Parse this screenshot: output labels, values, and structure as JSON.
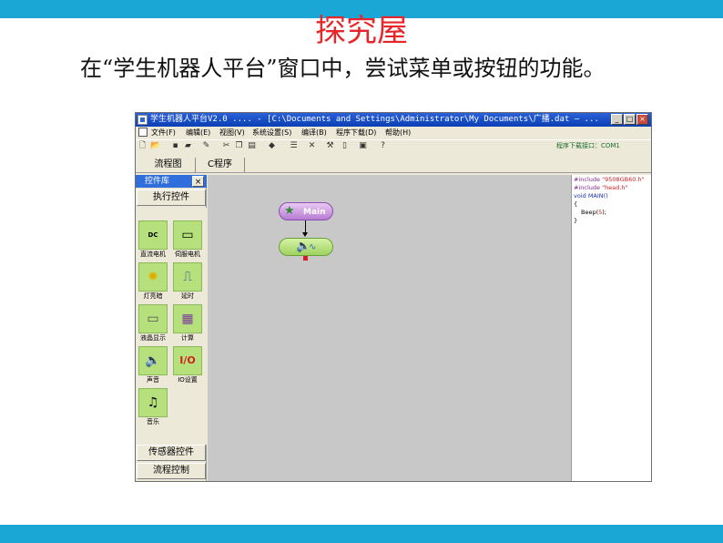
{
  "slide": {
    "title": "探究屋",
    "body": "在“学生机器人平台”窗口中，尝试菜单或按钮的功能。",
    "colors": {
      "band": "#1ba7d6",
      "title": "#e5262a"
    }
  },
  "window": {
    "title": "学生机器人平台V2.0 .... - [C:\\Documents and Settings\\Administrator\\My Documents\\广播.dat — ...",
    "buttons": {
      "minimize": "_",
      "maximize": "□",
      "close": "×"
    },
    "menu": [
      "文件(F)",
      "编辑(E)",
      "视图(V)",
      "系统设置(S)",
      "编译(B)",
      "程序下载(D)",
      "帮助(H)"
    ],
    "toolbar_icons": [
      "new-file-icon",
      "open-folder-icon",
      "save-icon",
      "folder-icon",
      "edit-icon",
      "cut-icon",
      "copy-icon",
      "paste-icon",
      "tag-icon",
      "list-icon",
      "delete-icon",
      "tools-icon",
      "document-icon",
      "disk-icon",
      "help-icon"
    ],
    "download_port": "程序下载接口：COM1",
    "tabs": [
      "流程图",
      "C程序"
    ]
  },
  "panel": {
    "header": "控件库",
    "close": "×",
    "category_exec": "执行控件",
    "category_sensor": "传感器控件",
    "category_flow": "流程控制",
    "items": [
      {
        "label": "直流电机",
        "icon": "dc-motor-icon"
      },
      {
        "label": "伺服电机",
        "icon": "servo-motor-icon"
      },
      {
        "label": "灯亮暗",
        "icon": "light-bulb-icon"
      },
      {
        "label": "延时",
        "icon": "delay-icon"
      },
      {
        "label": "液晶显示",
        "icon": "lcd-icon"
      },
      {
        "label": "计算",
        "icon": "calculator-icon"
      },
      {
        "label": "声音",
        "icon": "speaker-icon"
      },
      {
        "label": "IO设置",
        "icon": "io-icon"
      },
      {
        "label": "音乐",
        "icon": "music-icon"
      }
    ],
    "dc_badge": "DC",
    "io_text": "I/O"
  },
  "canvas": {
    "main_node": "Main"
  },
  "code": {
    "line1_pp": "#include",
    "line1_str": "\"9508GB60.h\"",
    "line2_pp": "#include",
    "line2_str": "\"head.h\"",
    "line3": "void MAIN()",
    "line4": "{",
    "line5_fn": "Beep(",
    "line5_num": "5",
    "line5_end": ");",
    "line6": "}"
  }
}
